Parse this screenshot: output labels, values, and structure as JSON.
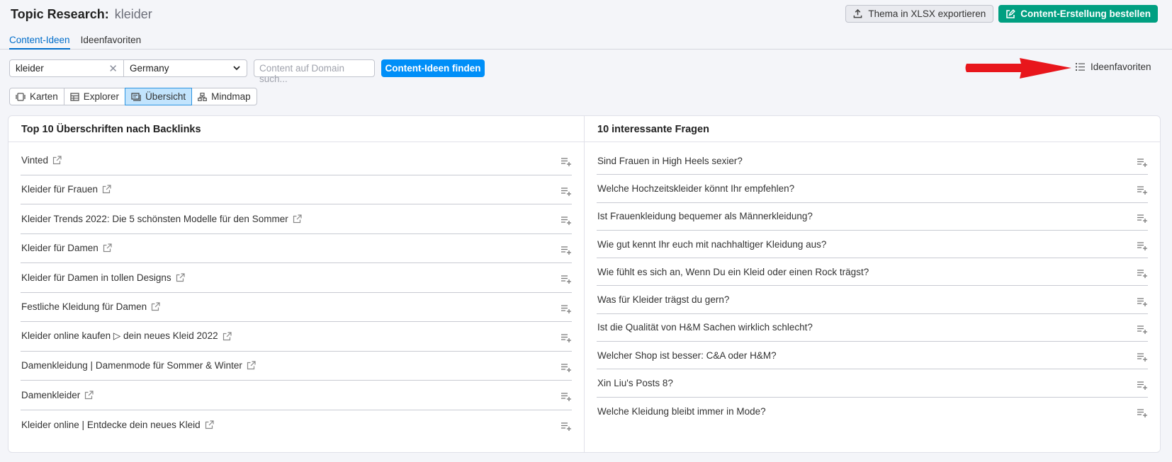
{
  "header": {
    "title": "Topic Research:",
    "keyword": "kleider",
    "export_label": "Thema in XLSX exportieren",
    "order_label": "Content-Erstellung bestellen"
  },
  "tabs": [
    {
      "label": "Content-Ideen",
      "active": true
    },
    {
      "label": "Ideenfavoriten",
      "active": false
    }
  ],
  "filters": {
    "keyword_value": "kleider",
    "country_value": "Germany",
    "domain_placeholder": "Content auf Domain such...",
    "find_label": "Content-Ideen finden"
  },
  "favorites_link": "Ideenfavoriten",
  "views": [
    {
      "label": "Karten",
      "icon": "cards-icon",
      "active": false
    },
    {
      "label": "Explorer",
      "icon": "table-icon",
      "active": false
    },
    {
      "label": "Übersicht",
      "icon": "overview-icon",
      "active": true
    },
    {
      "label": "Mindmap",
      "icon": "mindmap-icon",
      "active": false
    }
  ],
  "left": {
    "heading": "Top 10 Überschriften nach Backlinks",
    "rows": [
      "Vinted",
      "Kleider für Frauen",
      "Kleider Trends 2022: Die 5 schönsten Modelle für den Sommer",
      "Kleider für Damen",
      "Kleider für Damen in tollen Designs",
      "Festliche Kleidung für Damen",
      "Kleider online kaufen ▷ dein neues Kleid 2022",
      "Damenkleidung | Damenmode für Sommer & Winter",
      "Damenkleider",
      "Kleider online | Entdecke dein neues Kleid"
    ]
  },
  "right": {
    "heading": "10 interessante Fragen",
    "rows": [
      "Sind Frauen in High Heels sexier?",
      "Welche Hochzeitskleider könnt Ihr empfehlen?",
      "Ist Frauenkleidung bequemer als Männerkleidung?",
      "Wie gut kennt Ihr euch mit nachhaltiger Kleidung aus?",
      "Wie fühlt es sich an, Wenn Du ein Kleid oder einen Rock trägst?",
      "Was für Kleider trägst du gern?",
      "Ist die Qualität von H&M Sachen wirklich schlecht?",
      "Welcher Shop ist besser: C&A oder H&M?",
      "Xin Liu's Posts 8?",
      "Welche Kleidung bleibt immer in Mode?"
    ]
  },
  "colors": {
    "primary_blue": "#008ff8",
    "green": "#009f81",
    "arrow_red": "#e8161c",
    "active_tab": "#006dca"
  }
}
